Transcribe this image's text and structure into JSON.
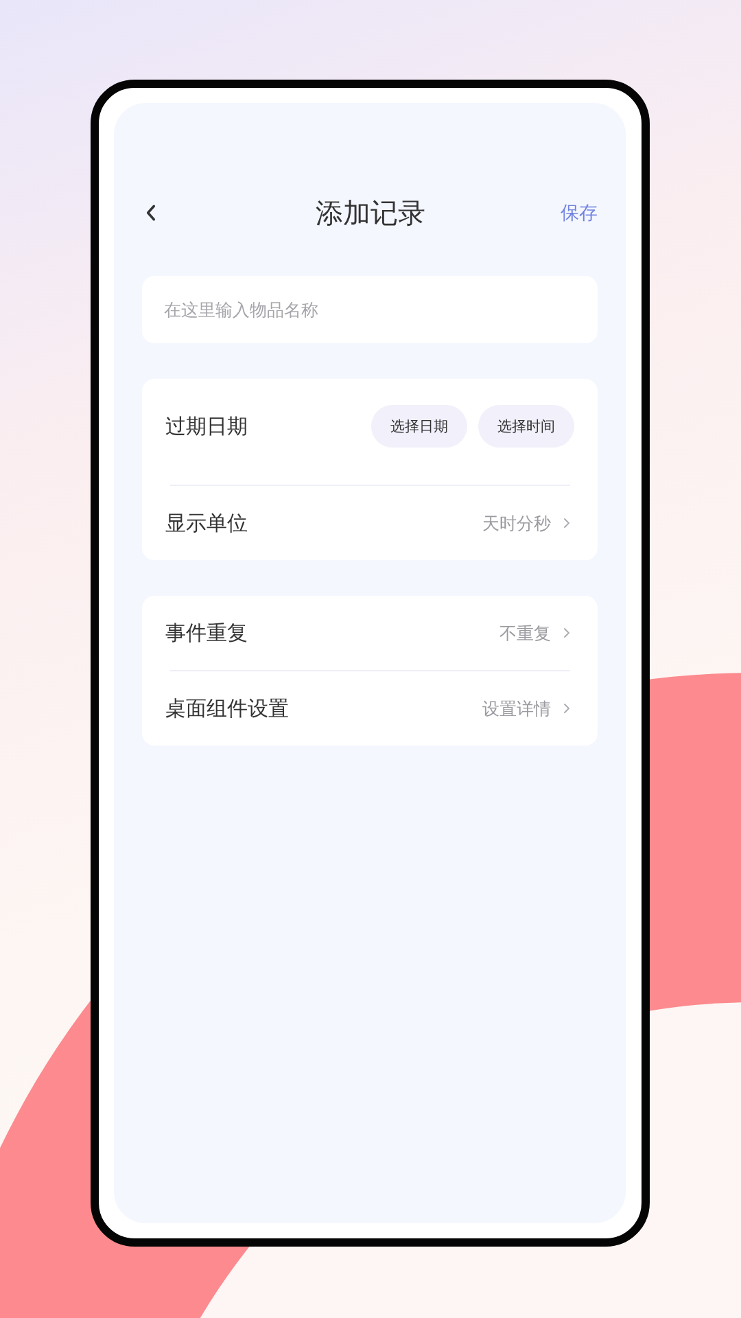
{
  "header": {
    "title": "添加记录",
    "action": "保存"
  },
  "name_field": {
    "placeholder": "在这里输入物品名称"
  },
  "sections": [
    {
      "rows": [
        {
          "kind": "buttons",
          "label": "过期日期",
          "buttons": [
            "选择日期",
            "选择时间"
          ]
        },
        {
          "kind": "link",
          "label": "显示单位",
          "value": "天时分秒"
        }
      ]
    },
    {
      "rows": [
        {
          "kind": "link",
          "label": "事件重复",
          "value": "不重复"
        },
        {
          "kind": "link",
          "label": "桌面组件设置",
          "value": "设置详情"
        }
      ]
    }
  ]
}
